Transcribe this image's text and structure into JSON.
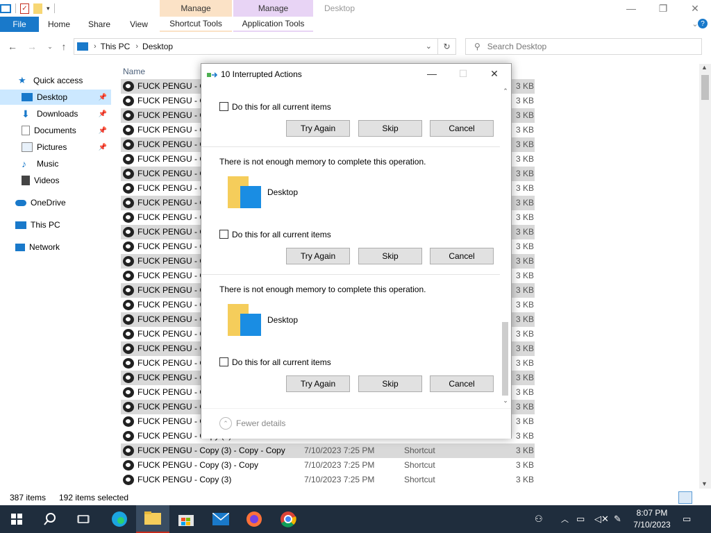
{
  "window": {
    "title": "Desktop",
    "context_tabs": [
      {
        "label": "Manage",
        "color": "#fbe2c6"
      },
      {
        "label": "Manage",
        "color": "#e8d4f5"
      }
    ]
  },
  "ribbon": {
    "tabs": [
      "File",
      "Home",
      "Share",
      "View",
      "Shortcut Tools",
      "Application Tools"
    ]
  },
  "address": {
    "crumbs": [
      "This PC",
      "Desktop"
    ],
    "search_placeholder": "Search Desktop"
  },
  "navpane": {
    "items": [
      {
        "label": "Quick access",
        "icon": "star-icon"
      },
      {
        "label": "Desktop",
        "icon": "desktop-folder-icon",
        "pinned": true,
        "selected": true
      },
      {
        "label": "Downloads",
        "icon": "download-icon",
        "pinned": true
      },
      {
        "label": "Documents",
        "icon": "documents-icon",
        "pinned": true
      },
      {
        "label": "Pictures",
        "icon": "pictures-icon",
        "pinned": true
      },
      {
        "label": "Music",
        "icon": "music-icon"
      },
      {
        "label": "Videos",
        "icon": "videos-icon"
      },
      {
        "label": "OneDrive",
        "icon": "cloud-icon"
      },
      {
        "label": "This PC",
        "icon": "computer-icon"
      },
      {
        "label": "Network",
        "icon": "network-icon"
      }
    ]
  },
  "filelist": {
    "column_name": "Name",
    "truncated_name": "FUCK PENGU - C",
    "truncated_size": "3 KB",
    "rows_visible": [
      {
        "name": "FUCK PENGU - Copy (3)",
        "date": "7/10/2023 7:25 PM",
        "type": "Shortcut",
        "size": "3 KB"
      },
      {
        "name": "FUCK PENGU - Copy (3) - Copy - Copy",
        "date": "7/10/2023 7:25 PM",
        "type": "Shortcut",
        "size": "3 KB"
      },
      {
        "name": "FUCK PENGU - Copy (3) - Copy",
        "date": "7/10/2023 7:25 PM",
        "type": "Shortcut",
        "size": "3 KB"
      },
      {
        "name": "FUCK PENGU - Copy (3)",
        "date": "7/10/2023 7:25 PM",
        "type": "Shortcut",
        "size": "3 KB"
      }
    ]
  },
  "status": {
    "items_count": "387 items",
    "selected_count": "192 items selected"
  },
  "dialog": {
    "title": "10 Interrupted Actions",
    "blocks": [
      {
        "message": "",
        "folder": "",
        "checkbox": "Do this for all current items"
      },
      {
        "message": "There is not enough memory to complete this operation.",
        "folder": "Desktop",
        "checkbox": "Do this for all current items"
      },
      {
        "message": "There is not enough memory to complete this operation.",
        "folder": "Desktop",
        "checkbox": "Do this for all current items"
      }
    ],
    "buttons": {
      "try_again": "Try Again",
      "skip": "Skip",
      "cancel": "Cancel"
    },
    "fewer_details": "Fewer details"
  },
  "taskbar": {
    "time": "8:07 PM",
    "date": "7/10/2023"
  }
}
